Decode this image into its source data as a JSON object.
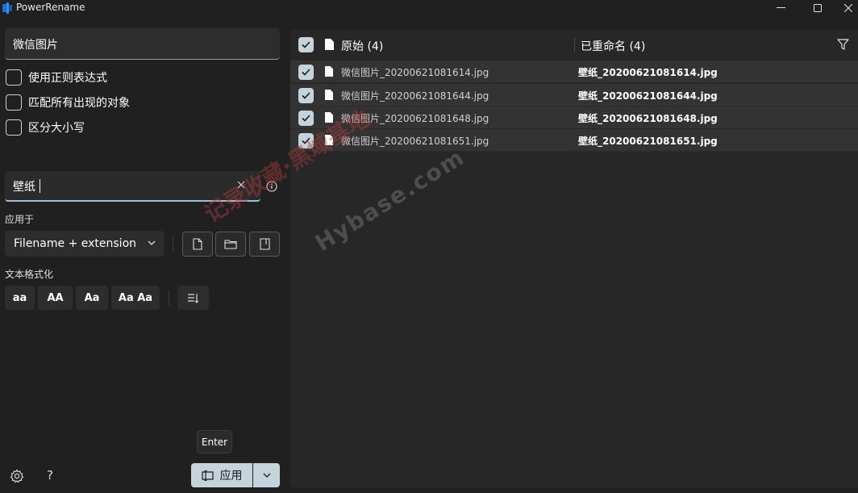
{
  "window": {
    "title": "PowerRename",
    "icon": "powerrename-app-icon",
    "controls": [
      "minimize-icon",
      "maximize-icon",
      "close-icon"
    ]
  },
  "search": {
    "value": "微信图片"
  },
  "options": [
    {
      "label": "使用正则表达式",
      "checked": false
    },
    {
      "label": "匹配所有出现的对象",
      "checked": false
    },
    {
      "label": "区分大小写",
      "checked": false
    }
  ],
  "replace": {
    "value": "壁纸",
    "clear_icon": "close-icon",
    "info_icon": "info-icon"
  },
  "apply_to": {
    "label": "应用于",
    "selected": "Filename + extension",
    "buttons": [
      "file-icon",
      "folder-icon",
      "subfolder-icon"
    ]
  },
  "text_format": {
    "label": "文本格式化",
    "buttons": [
      "aa",
      "AA",
      "Aa",
      "Aa Aa"
    ],
    "enumerate_icon": "enumerate-icon"
  },
  "footer": {
    "settings_icon": "gear-icon",
    "help_label": "?",
    "tooltip": "Enter",
    "apply_label": "应用",
    "apply_icon": "rename-icon"
  },
  "preview": {
    "original_header": "原始 (4)",
    "renamed_header": "已重命名 (4)",
    "filter_icon": "filter-icon",
    "rows": [
      {
        "original": "微信图片_20200621081614.jpg",
        "renamed": "壁纸_20200621081614.jpg",
        "checked": true
      },
      {
        "original": "微信图片_20200621081644.jpg",
        "renamed": "壁纸_20200621081644.jpg",
        "checked": true
      },
      {
        "original": "微信图片_20200621081648.jpg",
        "renamed": "壁纸_20200621081648.jpg",
        "checked": true
      },
      {
        "original": "微信图片_20200621081651.jpg",
        "renamed": "壁纸_20200621081651.jpg",
        "checked": true
      }
    ]
  },
  "watermark": {
    "line1": "记录收藏·黑域基地",
    "line2": "Hybase.com"
  },
  "colors": {
    "background": "#202020",
    "panel": "#272727",
    "row": "#333333",
    "accent": "#c5d3da",
    "input_underline": "#9ec0d6"
  }
}
